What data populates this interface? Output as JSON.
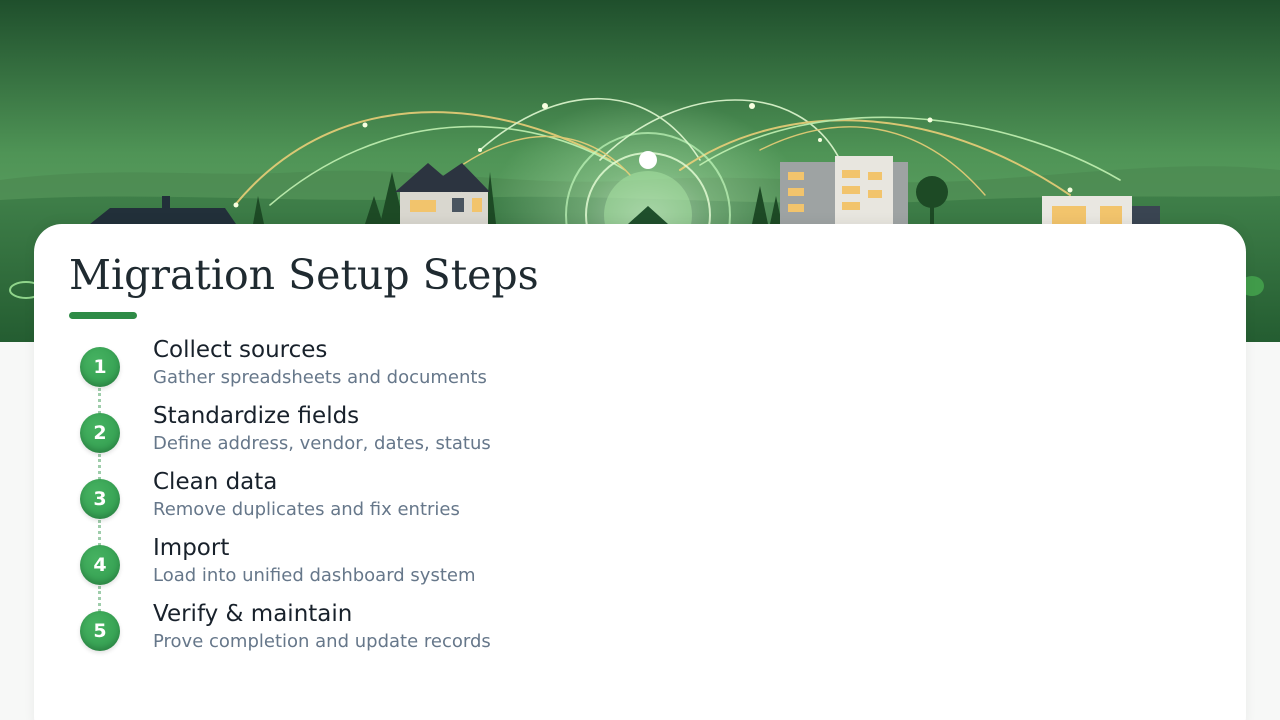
{
  "slide": {
    "title": "Migration Setup Steps",
    "steps": [
      {
        "number": "1",
        "title": "Collect sources",
        "description": "Gather spreadsheets and documents"
      },
      {
        "number": "2",
        "title": "Standardize fields",
        "description": "Define address, vendor, dates, status"
      },
      {
        "number": "3",
        "title": "Clean data",
        "description": "Remove duplicates and fix entries"
      },
      {
        "number": "4",
        "title": "Import",
        "description": "Load into unified dashboard system"
      },
      {
        "number": "5",
        "title": "Verify & maintain",
        "description": "Prove completion and update records"
      }
    ]
  },
  "colors": {
    "accent": "#2e8b46",
    "badge": "#2f9a4d",
    "connector": "#9fcdab",
    "title_text": "#1f2a30",
    "body_text": "#66778a",
    "banner_sky_top": "#1f5a2f",
    "banner_sky_bottom": "#6fae72"
  },
  "banner": {
    "icons": [
      "house-icon",
      "modern-house-icon",
      "apartment-building-icon",
      "network-hub-icon",
      "tree-icon"
    ]
  }
}
